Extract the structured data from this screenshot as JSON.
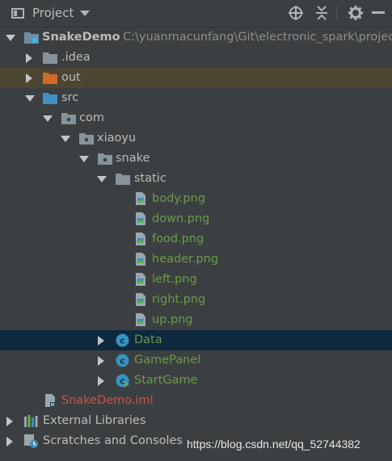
{
  "header": {
    "title": "Project",
    "icons": [
      "target-icon",
      "collapse-icon",
      "gear-icon",
      "minimize-icon"
    ]
  },
  "tree": {
    "root": {
      "name": "SnakeDemo",
      "path": "C:\\yuanmacunfang\\Git\\electronic_spark\\projec"
    },
    "idea": ".idea",
    "out": "out",
    "src": "src",
    "com": "com",
    "xiaoyu": "xiaoyu",
    "snake": "snake",
    "static": "static",
    "files": [
      "body.png",
      "down.png",
      "food.png",
      "header.png",
      "left.png",
      "right.png",
      "up.png"
    ],
    "classes": [
      "Data",
      "GamePanel",
      "StartGame"
    ],
    "iml": "SnakeDemo.iml",
    "external": "External Libraries",
    "scratches": "Scratches and Consoles"
  },
  "colors": {
    "panel_bg": "#3c3f41",
    "selected_row": "#0d293e",
    "excluded_row": "#4b4532",
    "file_green": "#6a9a4a",
    "iml_red": "#c75450",
    "folder_blue": "#3f8fbf",
    "folder_orange": "#d06a2a"
  },
  "watermark": "https://blog.csdn.net/qq_52744382"
}
